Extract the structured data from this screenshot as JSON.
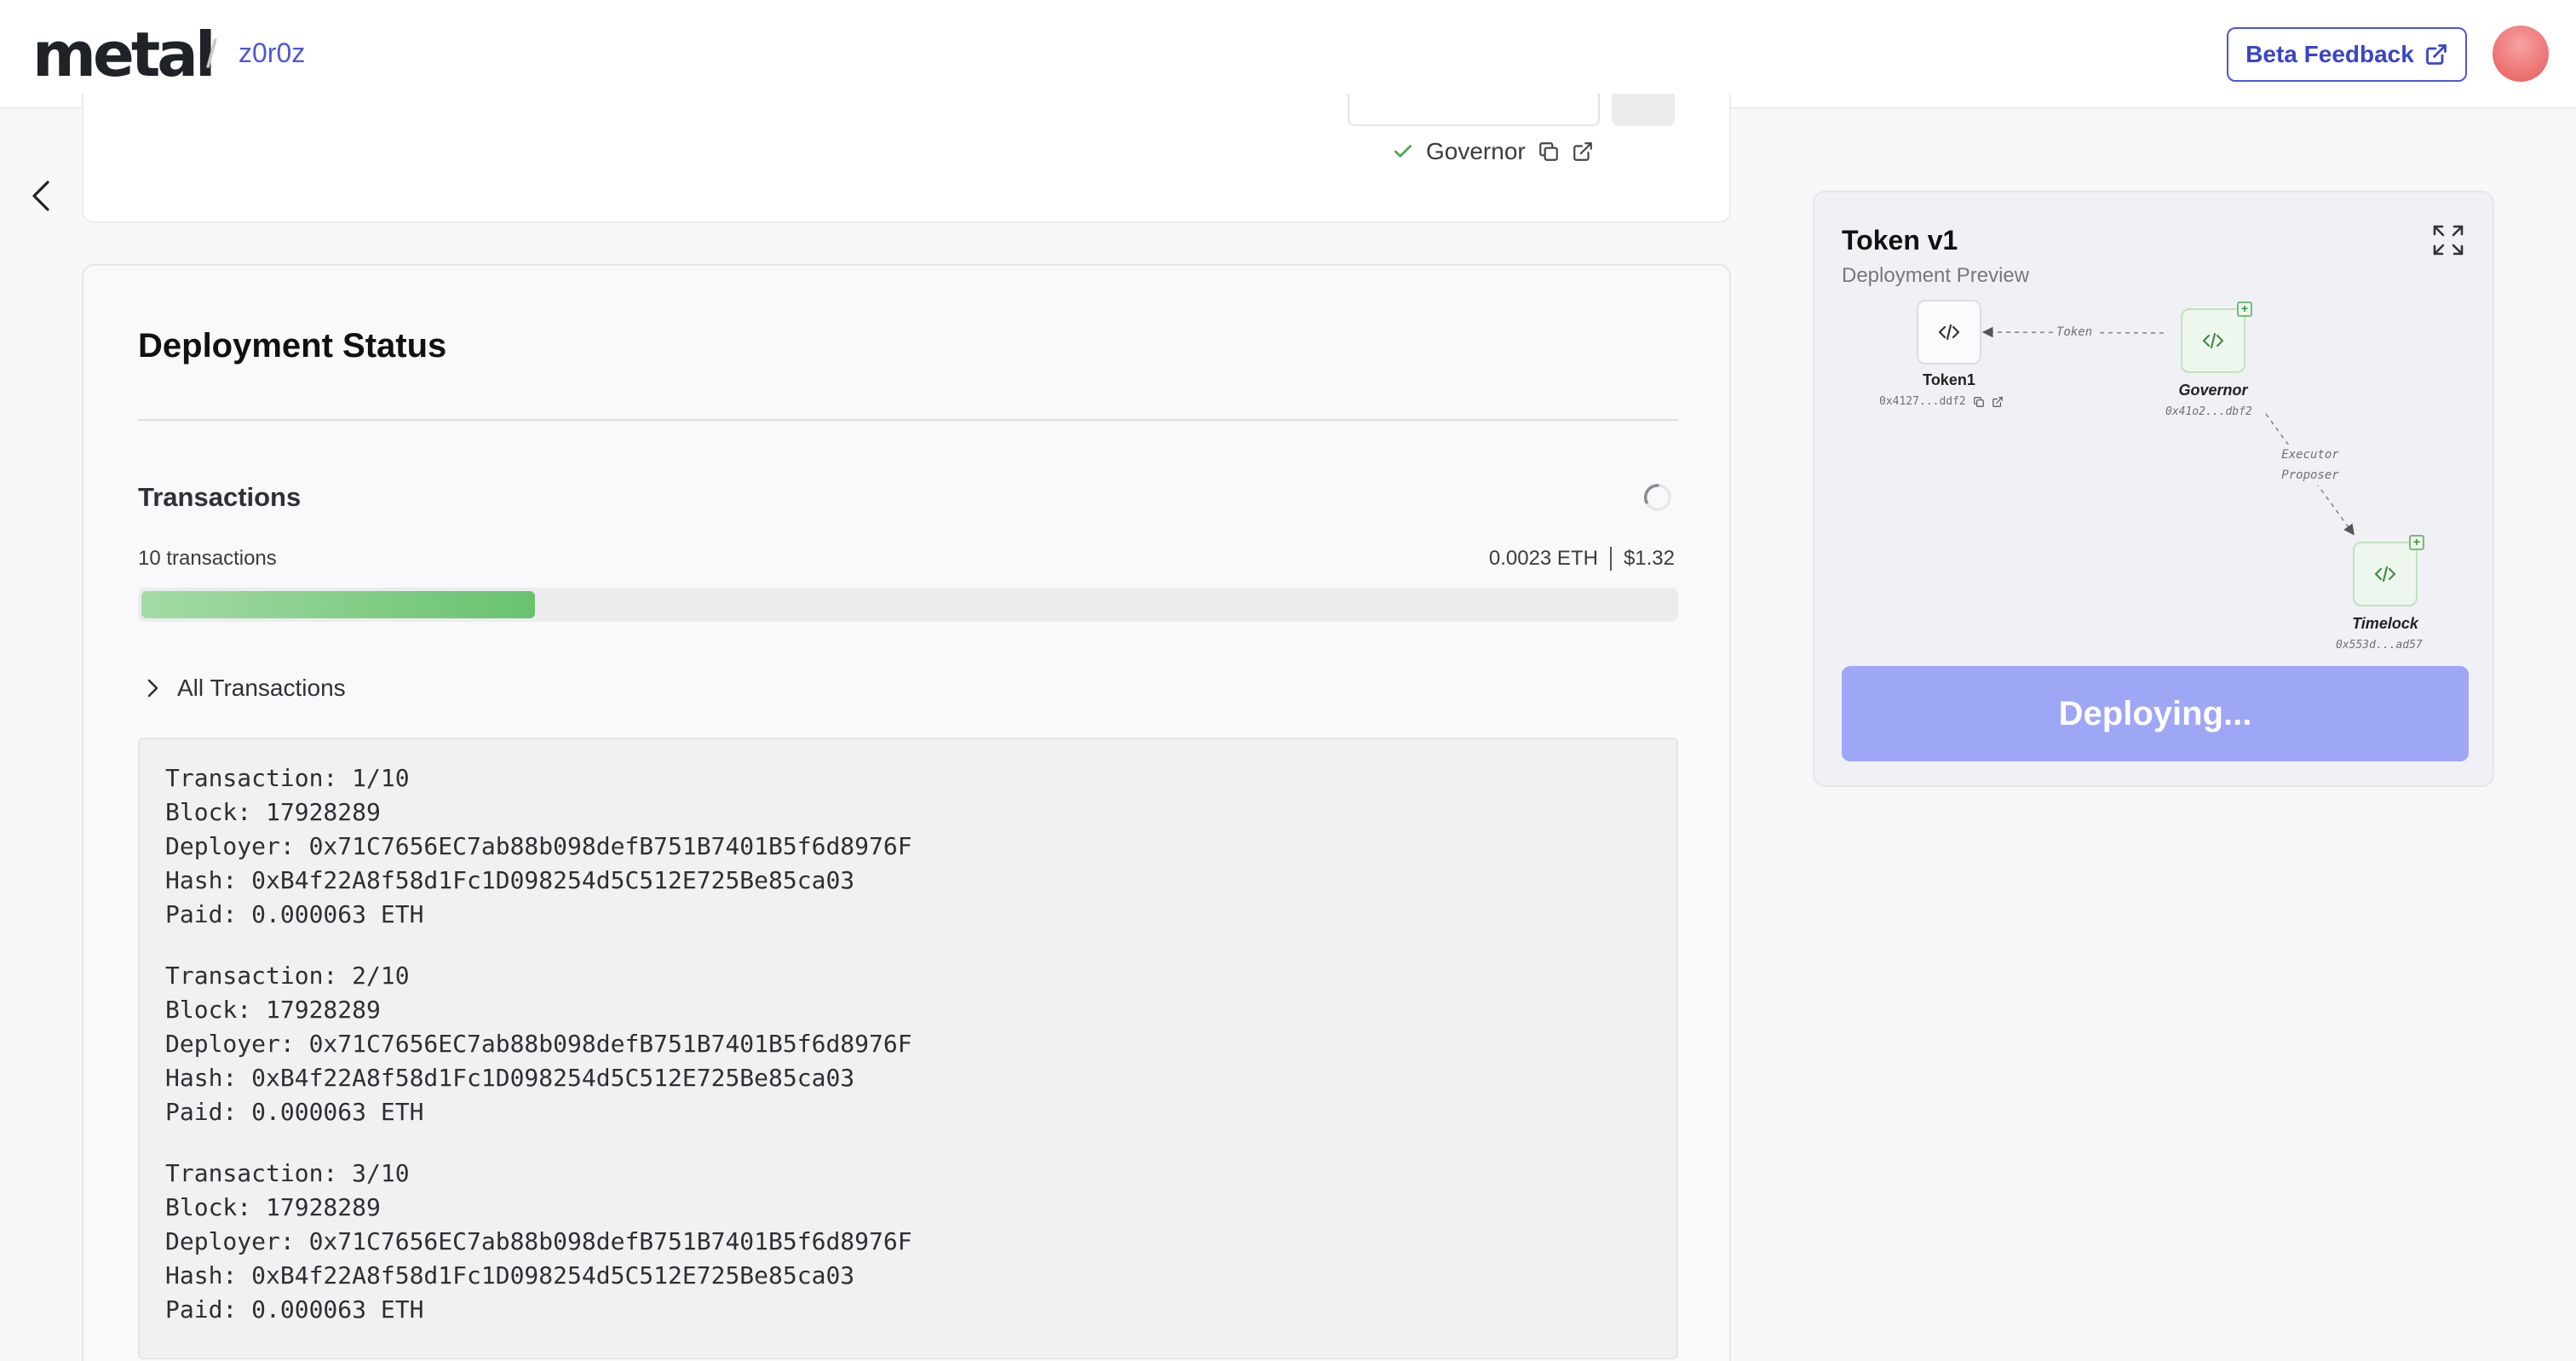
{
  "header": {
    "logo": "metal",
    "breadcrumb_sep": "/",
    "breadcrumb": "z0r0z",
    "beta_feedback_label": "Beta Feedback"
  },
  "top_card": {
    "governor_label": "Governor"
  },
  "status": {
    "title": "Deployment Status",
    "transactions_title": "Transactions",
    "count_label": "10 transactions",
    "eth_cost": "0.0023 ETH",
    "usd_cost": "$1.32",
    "progress_fraction": 0.26,
    "all_transactions_label": "All Transactions",
    "transactions": [
      {
        "tx": "Transaction: 1/10",
        "block": "Block: 17928289",
        "deployer": "Deployer: 0x71C7656EC7ab88b098defB751B7401B5f6d8976F",
        "hash": "Hash: 0xB4f22A8f58d1Fc1D098254d5C512E725Be85ca03",
        "paid": "Paid: 0.000063 ETH"
      },
      {
        "tx": "Transaction: 2/10",
        "block": "Block: 17928289",
        "deployer": "Deployer: 0x71C7656EC7ab88b098defB751B7401B5f6d8976F",
        "hash": "Hash: 0xB4f22A8f58d1Fc1D098254d5C512E725Be85ca03",
        "paid": "Paid: 0.000063 ETH"
      },
      {
        "tx": "Transaction: 3/10",
        "block": "Block: 17928289",
        "deployer": "Deployer: 0x71C7656EC7ab88b098defB751B7401B5f6d8976F",
        "hash": "Hash: 0xB4f22A8f58d1Fc1D098254d5C512E725Be85ca03",
        "paid": "Paid: 0.000063 ETH"
      }
    ]
  },
  "preview": {
    "title": "Token v1",
    "subtitle": "Deployment Preview",
    "nodes": {
      "token": {
        "label": "Token1",
        "address": "0x4127...ddf2"
      },
      "governor": {
        "label": "Governor",
        "address": "0x41o2...dbf2"
      },
      "timelock": {
        "label": "Timelock",
        "address": "0x553d...ad57"
      }
    },
    "edges": {
      "token_edge": "Token",
      "executor_edge": "Executor",
      "proposer_edge": "Proposer"
    },
    "deploy_label": "Deploying..."
  },
  "colors": {
    "accent": "#4d57d8",
    "deploy_button": "#9ea6f6",
    "progress": "#69c26f",
    "success": "#4ea857"
  }
}
